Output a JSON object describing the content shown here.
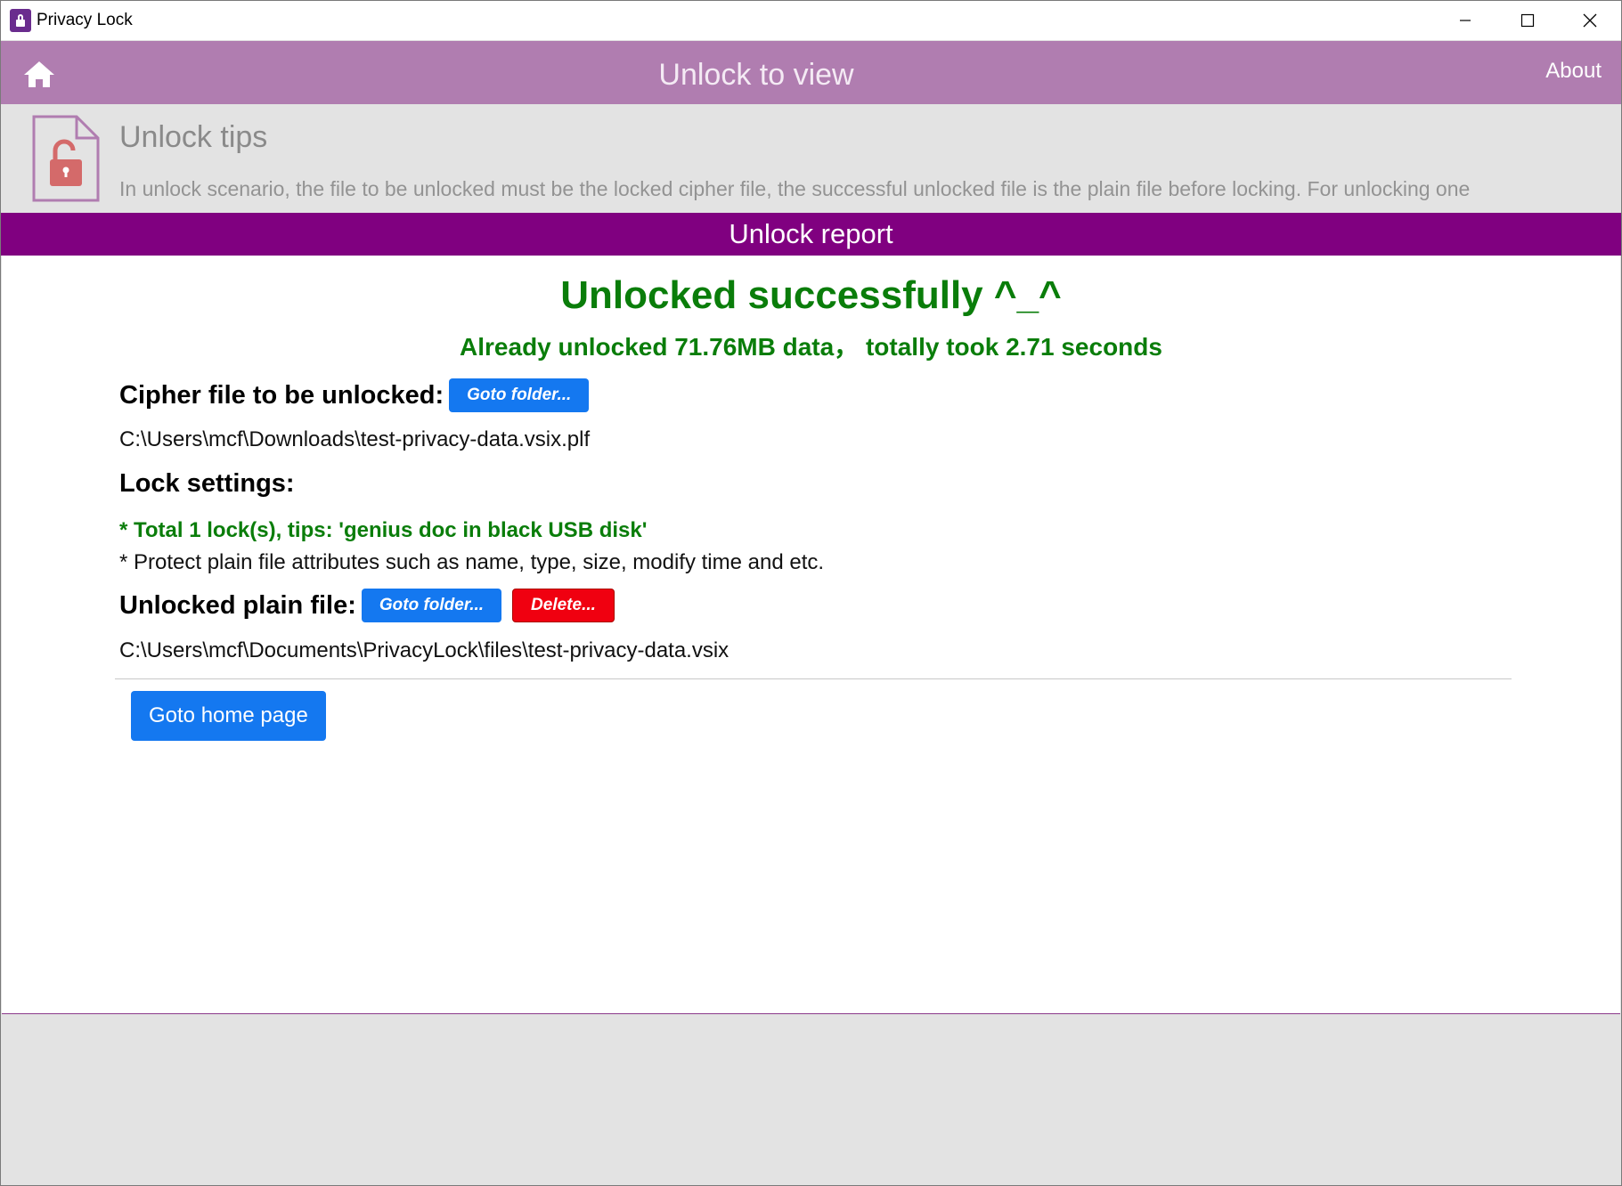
{
  "window": {
    "app_title": "Privacy Lock"
  },
  "header": {
    "title": "Unlock to view",
    "about_label": "About"
  },
  "tips": {
    "title": "Unlock tips",
    "text": "In unlock scenario, the file to be unlocked must be the locked cipher file, the successful unlocked file is the plain file before locking. For unlocking one"
  },
  "report": {
    "bar_title": "Unlock report",
    "success_title": "Unlocked successfully ^_^",
    "success_sub": "Already unlocked 71.76MB data， totally took 2.71 seconds",
    "cipher_label": "Cipher file to be unlocked:",
    "goto_folder_label": "Goto folder...",
    "cipher_path": "C:\\Users\\mcf\\Downloads\\test-privacy-data.vsix.plf",
    "lock_settings_label": "Lock settings:",
    "setting_locks": "* Total 1 lock(s), tips: 'genius doc in black USB disk'",
    "setting_attrs": "* Protect plain file attributes such as name, type, size, modify time and etc.",
    "plain_label": "Unlocked plain file:",
    "delete_label": "Delete...",
    "plain_path": "C:\\Users\\mcf\\Documents\\PrivacyLock\\files\\test-privacy-data.vsix",
    "home_button_label": "Goto home page"
  },
  "colors": {
    "header_bg": "#b07db0",
    "report_bar_bg": "#800080",
    "success_green": "#0a7d0a",
    "primary_button": "#1478f0",
    "danger_button": "#f00010"
  },
  "icons": {
    "app": "lock-app-icon",
    "home": "home-icon",
    "tips": "unlocked-document-icon",
    "minimize": "minimize-icon",
    "maximize": "maximize-icon",
    "close": "close-icon"
  }
}
